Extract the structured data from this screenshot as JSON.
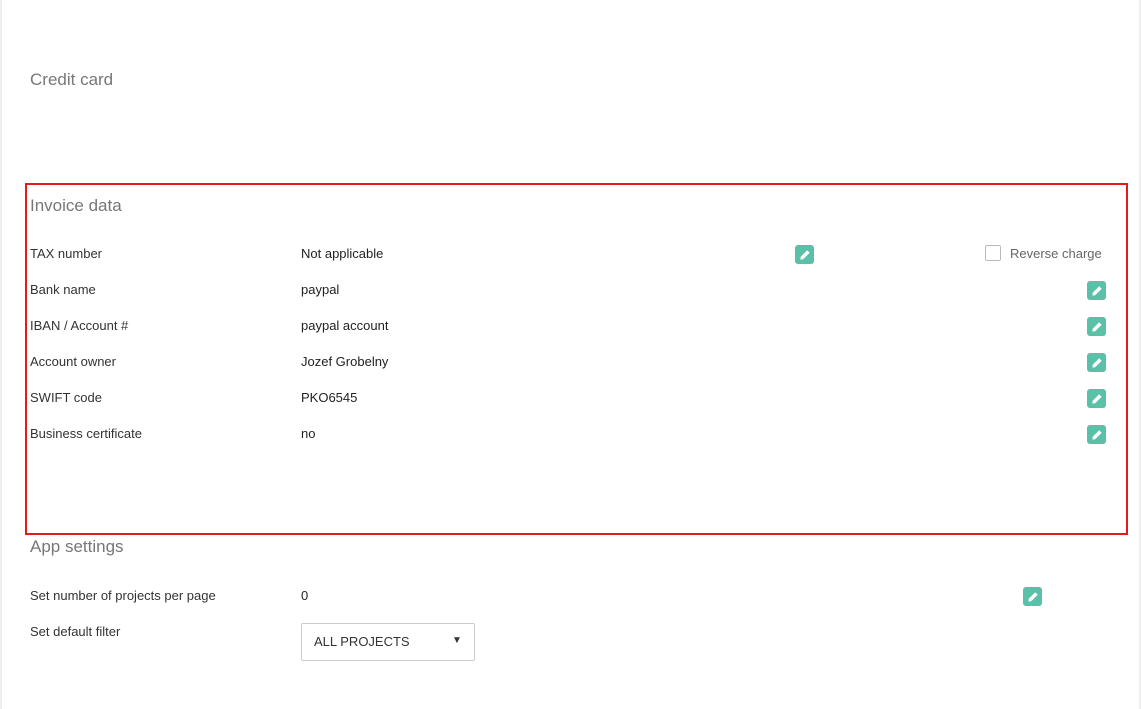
{
  "credit_card": {
    "title": "Credit card"
  },
  "invoice": {
    "title": "Invoice data",
    "reverse_charge_label": "Reverse charge",
    "reverse_charge_checked": false,
    "rows": [
      {
        "label": "TAX number",
        "value": "Not applicable"
      },
      {
        "label": "Bank name",
        "value": "paypal"
      },
      {
        "label": "IBAN / Account #",
        "value": "paypal account"
      },
      {
        "label": "Account owner",
        "value": "Jozef Grobelny"
      },
      {
        "label": "SWIFT code",
        "value": "PKO6545"
      },
      {
        "label": "Business certificate",
        "value": "no"
      }
    ]
  },
  "app_settings": {
    "title": "App settings",
    "projects_per_page_label": "Set number of projects per page",
    "projects_per_page_value": "0",
    "default_filter_label": "Set default filter",
    "default_filter_value": "ALL PROJECTS"
  },
  "icons": {
    "edit": "pencil-icon",
    "dropdown": "caret-down-icon"
  },
  "colors": {
    "edit_button": "#5bc0a8",
    "highlight_border": "#e31b1b"
  }
}
